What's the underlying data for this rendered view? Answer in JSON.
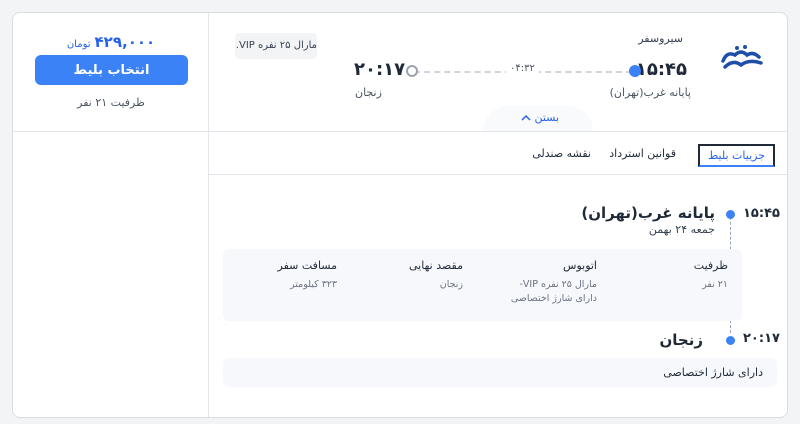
{
  "pricing": {
    "price": "۴۲۹,۰۰۰",
    "currency": "تومان",
    "select_label": "انتخاب بلیط",
    "capacity_text": "ظرفیت ۲۱ نفر"
  },
  "trip": {
    "company": "سیروسفر",
    "bus_type": "مارال ۲۵ نفره VIP...",
    "departure_time": "۱۵:۴۵",
    "arrival_time": "۲۰:۱۷",
    "duration": "۰۴:۳۲",
    "origin_station": "پایانه غرب(تهران)",
    "destination_station": "زنجان",
    "collapse_label": "بستن"
  },
  "tabs": [
    {
      "label": "جزییات بلیط",
      "active": true
    },
    {
      "label": "قوانین استرداد",
      "active": false
    },
    {
      "label": "نقشه صندلی",
      "active": false
    }
  ],
  "details": {
    "origin_time": "۱۵:۴۵",
    "origin_name": "پایانه غرب(تهران)",
    "origin_date": "جمعه ۲۴ بهمن",
    "destination_time": "۲۰:۱۷",
    "destination_name": "زنجان",
    "info": [
      {
        "heading": "ظرفیت",
        "value": "۲۱ نفر"
      },
      {
        "heading": "اتوبوس",
        "value": "مارال ۲۵ نفره VIP-\nدارای شارژ اختصاصی"
      },
      {
        "heading": "مقصد نهایی",
        "value": "زنجان"
      },
      {
        "heading": "مسافت سفر",
        "value": "۳۲۳ کیلومتر"
      }
    ],
    "feature": "دارای شارژ اختصاصی"
  },
  "colors": {
    "accent": "#3b82f6",
    "price": "#2563eb",
    "border": "#d9dde3"
  },
  "icons": [
    "company-logo-icon",
    "chevron-up-icon"
  ]
}
